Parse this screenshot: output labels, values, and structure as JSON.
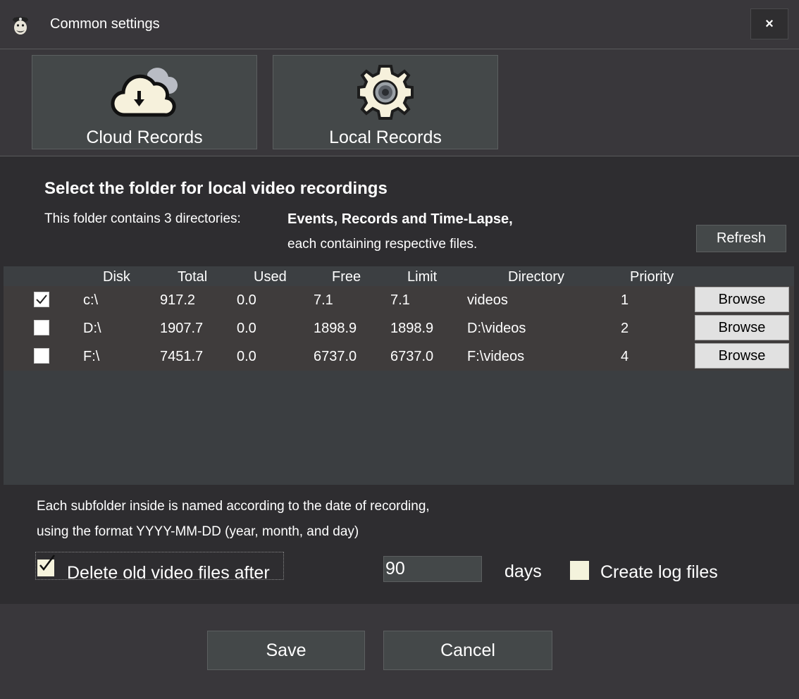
{
  "window": {
    "title": "Common settings",
    "close_label": "×"
  },
  "tabs": [
    {
      "label": "Cloud Records"
    },
    {
      "label": "Local Records"
    }
  ],
  "section": {
    "heading": "Select the folder for local video recordings",
    "info_prefix": "This folder contains 3 directories:",
    "info_bold": "Events, Records and Time-Lapse,",
    "info_suffix": "each containing respective files.",
    "refresh_label": "Refresh"
  },
  "table": {
    "headers": [
      "Disk",
      "Total",
      "Used",
      "Free",
      "Limit",
      "Directory",
      "Priority"
    ],
    "rows": [
      {
        "checked": true,
        "disk": "c:\\",
        "total": "917.2",
        "used": "0.0",
        "free": "7.1",
        "limit": "7.1",
        "directory": "videos",
        "priority": "1",
        "browse": "Browse"
      },
      {
        "checked": false,
        "disk": "D:\\",
        "total": "1907.7",
        "used": "0.0",
        "free": "1898.9",
        "limit": "1898.9",
        "directory": "D:\\videos",
        "priority": "2",
        "browse": "Browse"
      },
      {
        "checked": false,
        "disk": "F:\\",
        "total": "7451.7",
        "used": "0.0",
        "free": "6737.0",
        "limit": "6737.0",
        "directory": "F:\\videos",
        "priority": "4",
        "browse": "Browse"
      }
    ]
  },
  "notes": {
    "line1": "Each subfolder inside is named according to the date of recording,",
    "line2": "using the format YYYY-MM-DD (year, month, and day)"
  },
  "options": {
    "delete_label": "Delete old video files after",
    "delete_checked": true,
    "days_value": "90",
    "days_label": "days",
    "log_label": "Create log files",
    "log_checked": false
  },
  "footer": {
    "save_label": "Save",
    "cancel_label": "Cancel"
  },
  "colors": {
    "background": "#39373b",
    "panel": "#2e2d30",
    "button": "#444849",
    "accent_cream": "#f6f1dc"
  }
}
